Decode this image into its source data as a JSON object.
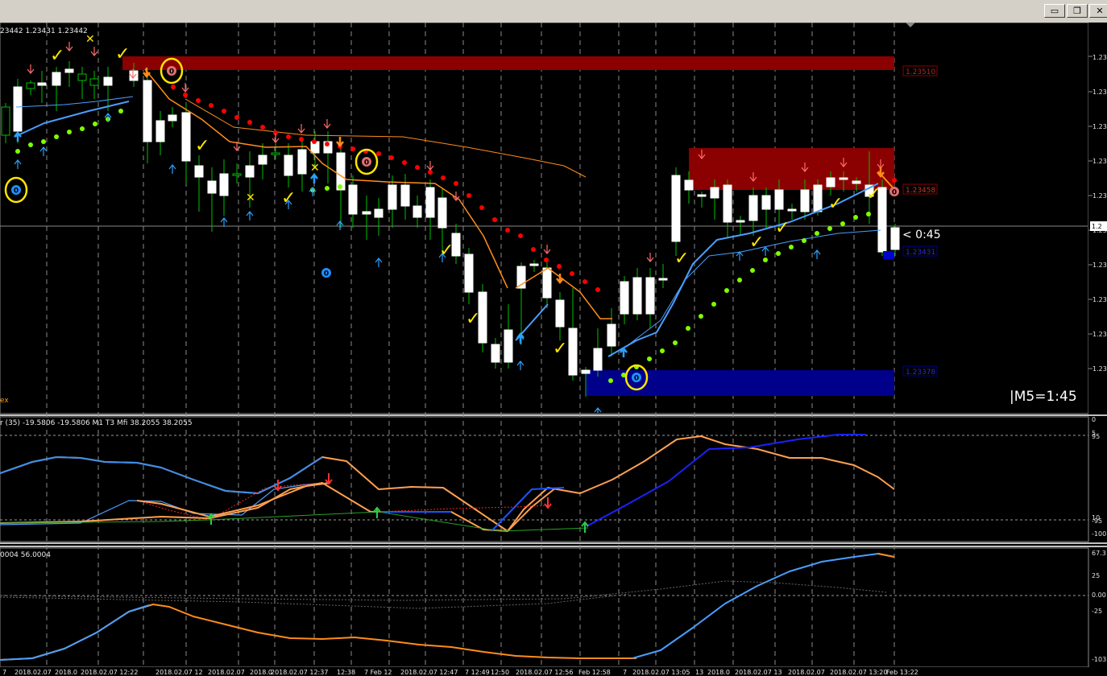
{
  "window": {
    "controls": {
      "minimize": "▭",
      "restore": "❐",
      "close": "✕"
    },
    "close_color": "#c0392b"
  },
  "main_chart": {
    "ohlc_header": "23442 1.23431 1.23442",
    "indicator_label": "ex",
    "countdown_label": "< 0:45",
    "timeframe_timer": "|M5=1:45",
    "price_tags": {
      "upper_resistance": "1.23510",
      "lower_resistance": "1.23458",
      "current_bid": "1.23431",
      "support": "1.23378"
    },
    "price_axis_labels": [
      "1.23",
      "1.23",
      "1.23",
      "1.23",
      "1.23",
      "1.23",
      "1.23",
      "1.23",
      "1.23",
      "1.23"
    ],
    "current_price_label": "1.2",
    "colors": {
      "bull_body": "#000000",
      "bull_outline": "#00c000",
      "bear_body": "#ffffff",
      "resistance_zone": "#8b0000",
      "support_zone": "#00008b",
      "sar_high": "#ff0000",
      "sar_low": "#7fff00",
      "fast_ma": "#4a9eff",
      "slow_ma": "#ff8c1a",
      "arrow_up": "#2aa0ff",
      "arrow_down": "#ff6b6b",
      "marker_yellow": "#ffe600"
    }
  },
  "subwindow1": {
    "label": "r (35) -19.5806 -19.5806  M1  T3 Mfi  38.2055 38.2055",
    "axis_labels": [
      "0",
      "95",
      "5",
      "10",
      "-95",
      "-100"
    ]
  },
  "subwindow2": {
    "label": "0004 56.0004",
    "axis_labels": [
      "67.3",
      "25",
      "0.00",
      "-25",
      "-103"
    ]
  },
  "time_axis": [
    "7",
    "2018.02.07",
    "2018.0",
    "2018.02.07 12:22",
    "2018.02.07 12",
    "2018.02.07",
    "2018.0",
    "2018.02.07 12:37",
    "12:38",
    "7 Feb 12",
    "2018.02.07 12:47",
    "7 12:49",
    "12:50",
    "2018.02.07 12:56",
    "Feb 12:58",
    "7",
    "2018.02.07 13:05",
    "13",
    "2018.0",
    "2018.02.07 13",
    "2018.02.07",
    "2018.02.07 13:20",
    "Feb 13:22"
  ],
  "markers": {
    "zero": "0",
    "check": "✓",
    "cross": "✕"
  }
}
